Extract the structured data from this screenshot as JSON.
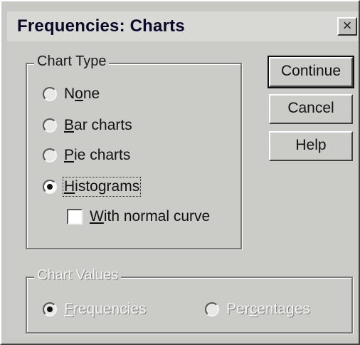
{
  "window": {
    "title": "Frequencies: Charts",
    "close_label": "×"
  },
  "chart_type": {
    "legend": "Chart Type",
    "options": [
      {
        "pre": "N",
        "accel": "o",
        "post": "ne",
        "checked": false
      },
      {
        "pre": "",
        "accel": "B",
        "post": "ar charts",
        "checked": false
      },
      {
        "pre": "",
        "accel": "P",
        "post": "ie charts",
        "checked": false
      },
      {
        "pre": "",
        "accel": "H",
        "post": "istograms",
        "checked": true
      }
    ],
    "normal_curve": {
      "pre": "",
      "accel": "W",
      "post": "ith normal curve",
      "checked": false
    }
  },
  "chart_values": {
    "legend": "Chart Values",
    "options": [
      {
        "pre": "",
        "accel": "F",
        "post": "requencies",
        "checked": true
      },
      {
        "pre": "Per",
        "accel": "c",
        "post": "entages",
        "checked": false
      }
    ]
  },
  "buttons": {
    "continue": "Continue",
    "cancel": "Cancel",
    "help": "Help"
  }
}
